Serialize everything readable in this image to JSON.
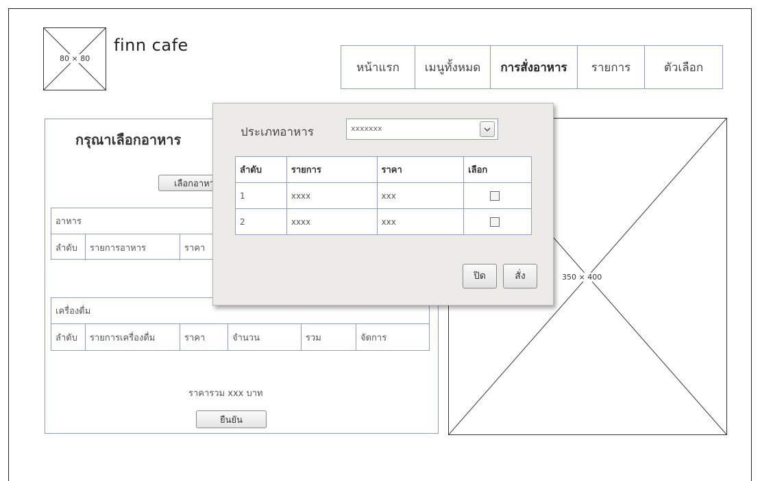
{
  "logo": {
    "placeholder_label": "80 × 80",
    "brand": "finn cafe"
  },
  "nav": {
    "items": [
      {
        "label": "หน้าแรก",
        "active": false
      },
      {
        "label": "เมนูทั้งหมด",
        "active": false
      },
      {
        "label": "การสั่งอาหาร",
        "active": true
      },
      {
        "label": "รายการ",
        "active": false
      },
      {
        "label": "ตัวเลือก",
        "active": false
      }
    ]
  },
  "order_panel": {
    "title": "กรุณาเลือกอาหาร",
    "choose_food_button": "เลือกอาหาร",
    "food_section": {
      "heading": "อาหาร",
      "columns": [
        "ลำดับ",
        "รายการอาหาร",
        "ราคา"
      ]
    },
    "drink_section": {
      "heading": "เครื่องดื่ม",
      "columns": [
        "ลำดับ",
        "รายการเครื่องดื่ม",
        "ราคา",
        "จำนวน",
        "รวม",
        "จัดการ"
      ]
    },
    "total_text": "ราคารวม xxx บาท",
    "confirm_button": "ยืนยัน"
  },
  "image_placeholder": {
    "label": "350 × 400"
  },
  "modal": {
    "category_label": "ประเภทอาหาร",
    "category_value": "xxxxxxx",
    "columns": [
      "ลำดับ",
      "รายการ",
      "ราคา",
      "เลือก"
    ],
    "rows": [
      {
        "no": "1",
        "item": "xxxx",
        "price": "xxx",
        "checked": false
      },
      {
        "no": "2",
        "item": "xxxx",
        "price": "xxx",
        "checked": false
      }
    ],
    "close_button": "ปิด",
    "order_button": "สั่ง"
  },
  "colors": {
    "border_accent": "#8aa0b8",
    "modal_bg": "#ecebe7"
  },
  "icons": {
    "select_arrow": "chevron-down-icon",
    "checkbox": "checkbox-icon"
  }
}
